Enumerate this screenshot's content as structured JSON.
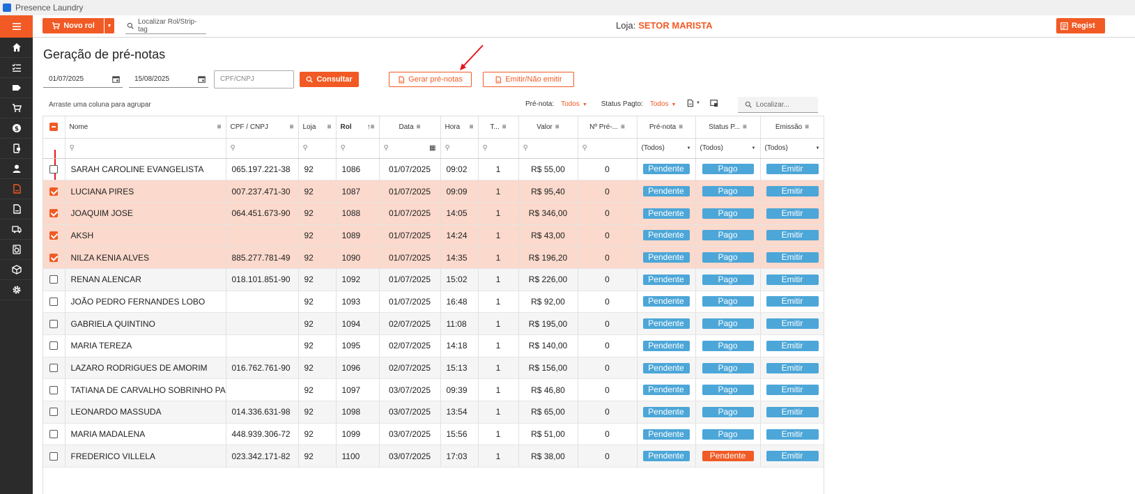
{
  "window": {
    "title": "Presence Laundry"
  },
  "toolbar": {
    "novo_rol": "Novo rol",
    "locate_placeholder": "Localizar Rol/Strip-tag",
    "loja_label": "Loja:",
    "loja_value": "SETOR MARISTA",
    "regist_label": "Regist"
  },
  "sidebar": {
    "items": [
      "home-icon",
      "checklist-icon",
      "tag-icon",
      "cart-icon",
      "dollar-icon",
      "phone-card-icon",
      "user-icon",
      "document-icon",
      "document-icon",
      "truck-icon",
      "washer-icon",
      "box-icon",
      "gear-icon"
    ],
    "active_index": 7
  },
  "main": {
    "title": "Geração de pré-notas",
    "date_start": "01/07/2025",
    "date_end": "15/08/2025",
    "cpf_placeholder": "CPF/CNPJ",
    "consultar": "Consultar",
    "gerar": "Gerar pré-notas",
    "emitir": "Emitir/Não emitir",
    "group_hint": "Arraste uma coluna para agrupar",
    "filter_prenota_label": "Pré-nota:",
    "filter_prenota_value": "Todos",
    "filter_status_label": "Status Pagto:",
    "filter_status_value": "Todos",
    "locate_grid_placeholder": "Localizar..."
  },
  "grid": {
    "columns": [
      "Nome",
      "CPF / CNPJ",
      "Loja",
      "Rol",
      "Data",
      "Hora",
      "T...",
      "Valor",
      "Nº Pré-...",
      "Pré-nota",
      "Status P...",
      "Emissão"
    ],
    "filter_all": "(Todos)",
    "rows": [
      {
        "sel": false,
        "nome": "SARAH CAROLINE EVANGELISTA",
        "cpf": "065.197.221-38",
        "loja": "92",
        "rol": "1086",
        "data": "01/07/2025",
        "hora": "09:02",
        "t": "1",
        "valor": "R$ 55,00",
        "npre": "0",
        "prenota": "Pendente",
        "status": "Pago",
        "emissao": "Emitir"
      },
      {
        "sel": true,
        "nome": "LUCIANA PIRES",
        "cpf": "007.237.471-30",
        "loja": "92",
        "rol": "1087",
        "data": "01/07/2025",
        "hora": "09:09",
        "t": "1",
        "valor": "R$ 95,40",
        "npre": "0",
        "prenota": "Pendente",
        "status": "Pago",
        "emissao": "Emitir"
      },
      {
        "sel": true,
        "nome": "JOAQUIM JOSE",
        "cpf": "064.451.673-90",
        "loja": "92",
        "rol": "1088",
        "data": "01/07/2025",
        "hora": "14:05",
        "t": "1",
        "valor": "R$ 346,00",
        "npre": "0",
        "prenota": "Pendente",
        "status": "Pago",
        "emissao": "Emitir"
      },
      {
        "sel": true,
        "nome": "AKSH",
        "cpf": "",
        "loja": "92",
        "rol": "1089",
        "data": "01/07/2025",
        "hora": "14:24",
        "t": "1",
        "valor": "R$ 43,00",
        "npre": "0",
        "prenota": "Pendente",
        "status": "Pago",
        "emissao": "Emitir"
      },
      {
        "sel": true,
        "nome": "NILZA KENIA ALVES",
        "cpf": "885.277.781-49",
        "loja": "92",
        "rol": "1090",
        "data": "01/07/2025",
        "hora": "14:35",
        "t": "1",
        "valor": "R$ 196,20",
        "npre": "0",
        "prenota": "Pendente",
        "status": "Pago",
        "emissao": "Emitir"
      },
      {
        "sel": false,
        "nome": "RENAN ALENCAR",
        "cpf": "018.101.851-90",
        "loja": "92",
        "rol": "1092",
        "data": "01/07/2025",
        "hora": "15:02",
        "t": "1",
        "valor": "R$ 226,00",
        "npre": "0",
        "prenota": "Pendente",
        "status": "Pago",
        "emissao": "Emitir"
      },
      {
        "sel": false,
        "nome": "JOÃO PEDRO FERNANDES LOBO",
        "cpf": "",
        "loja": "92",
        "rol": "1093",
        "data": "01/07/2025",
        "hora": "16:48",
        "t": "1",
        "valor": "R$ 92,00",
        "npre": "0",
        "prenota": "Pendente",
        "status": "Pago",
        "emissao": "Emitir"
      },
      {
        "sel": false,
        "nome": "GABRIELA QUINTINO",
        "cpf": "",
        "loja": "92",
        "rol": "1094",
        "data": "02/07/2025",
        "hora": "11:08",
        "t": "1",
        "valor": "R$ 195,00",
        "npre": "0",
        "prenota": "Pendente",
        "status": "Pago",
        "emissao": "Emitir"
      },
      {
        "sel": false,
        "nome": "MARIA TEREZA",
        "cpf": "",
        "loja": "92",
        "rol": "1095",
        "data": "02/07/2025",
        "hora": "14:18",
        "t": "1",
        "valor": "R$ 140,00",
        "npre": "0",
        "prenota": "Pendente",
        "status": "Pago",
        "emissao": "Emitir"
      },
      {
        "sel": false,
        "nome": "LAZARO RODRIGUES DE AMORIM",
        "cpf": "016.762.761-90",
        "loja": "92",
        "rol": "1096",
        "data": "02/07/2025",
        "hora": "15:13",
        "t": "1",
        "valor": "R$ 156,00",
        "npre": "0",
        "prenota": "Pendente",
        "status": "Pago",
        "emissao": "Emitir"
      },
      {
        "sel": false,
        "nome": "TATIANA DE CARVALHO SOBRINHO PAZ",
        "cpf": "",
        "loja": "92",
        "rol": "1097",
        "data": "03/07/2025",
        "hora": "09:39",
        "t": "1",
        "valor": "R$ 46,80",
        "npre": "0",
        "prenota": "Pendente",
        "status": "Pago",
        "emissao": "Emitir"
      },
      {
        "sel": false,
        "nome": "LEONARDO MASSUDA",
        "cpf": "014.336.631-98",
        "loja": "92",
        "rol": "1098",
        "data": "03/07/2025",
        "hora": "13:54",
        "t": "1",
        "valor": "R$ 65,00",
        "npre": "0",
        "prenota": "Pendente",
        "status": "Pago",
        "emissao": "Emitir"
      },
      {
        "sel": false,
        "nome": "MARIA MADALENA",
        "cpf": "448.939.306-72",
        "loja": "92",
        "rol": "1099",
        "data": "03/07/2025",
        "hora": "15:56",
        "t": "1",
        "valor": "R$ 51,00",
        "npre": "0",
        "prenota": "Pendente",
        "status": "Pago",
        "emissao": "Emitir"
      },
      {
        "sel": false,
        "nome": "FREDERICO VILLELA",
        "cpf": "023.342.171-82",
        "loja": "92",
        "rol": "1100",
        "data": "03/07/2025",
        "hora": "17:03",
        "t": "1",
        "valor": "R$ 38,00",
        "npre": "0",
        "prenota": "Pendente",
        "status": "Pendente",
        "emissao": "Emitir"
      }
    ]
  },
  "colors": {
    "accent": "#f15a24",
    "badge_blue": "#4ca6d8",
    "selected_row": "#fbd9cc",
    "sidebar": "#2b2b2b"
  }
}
